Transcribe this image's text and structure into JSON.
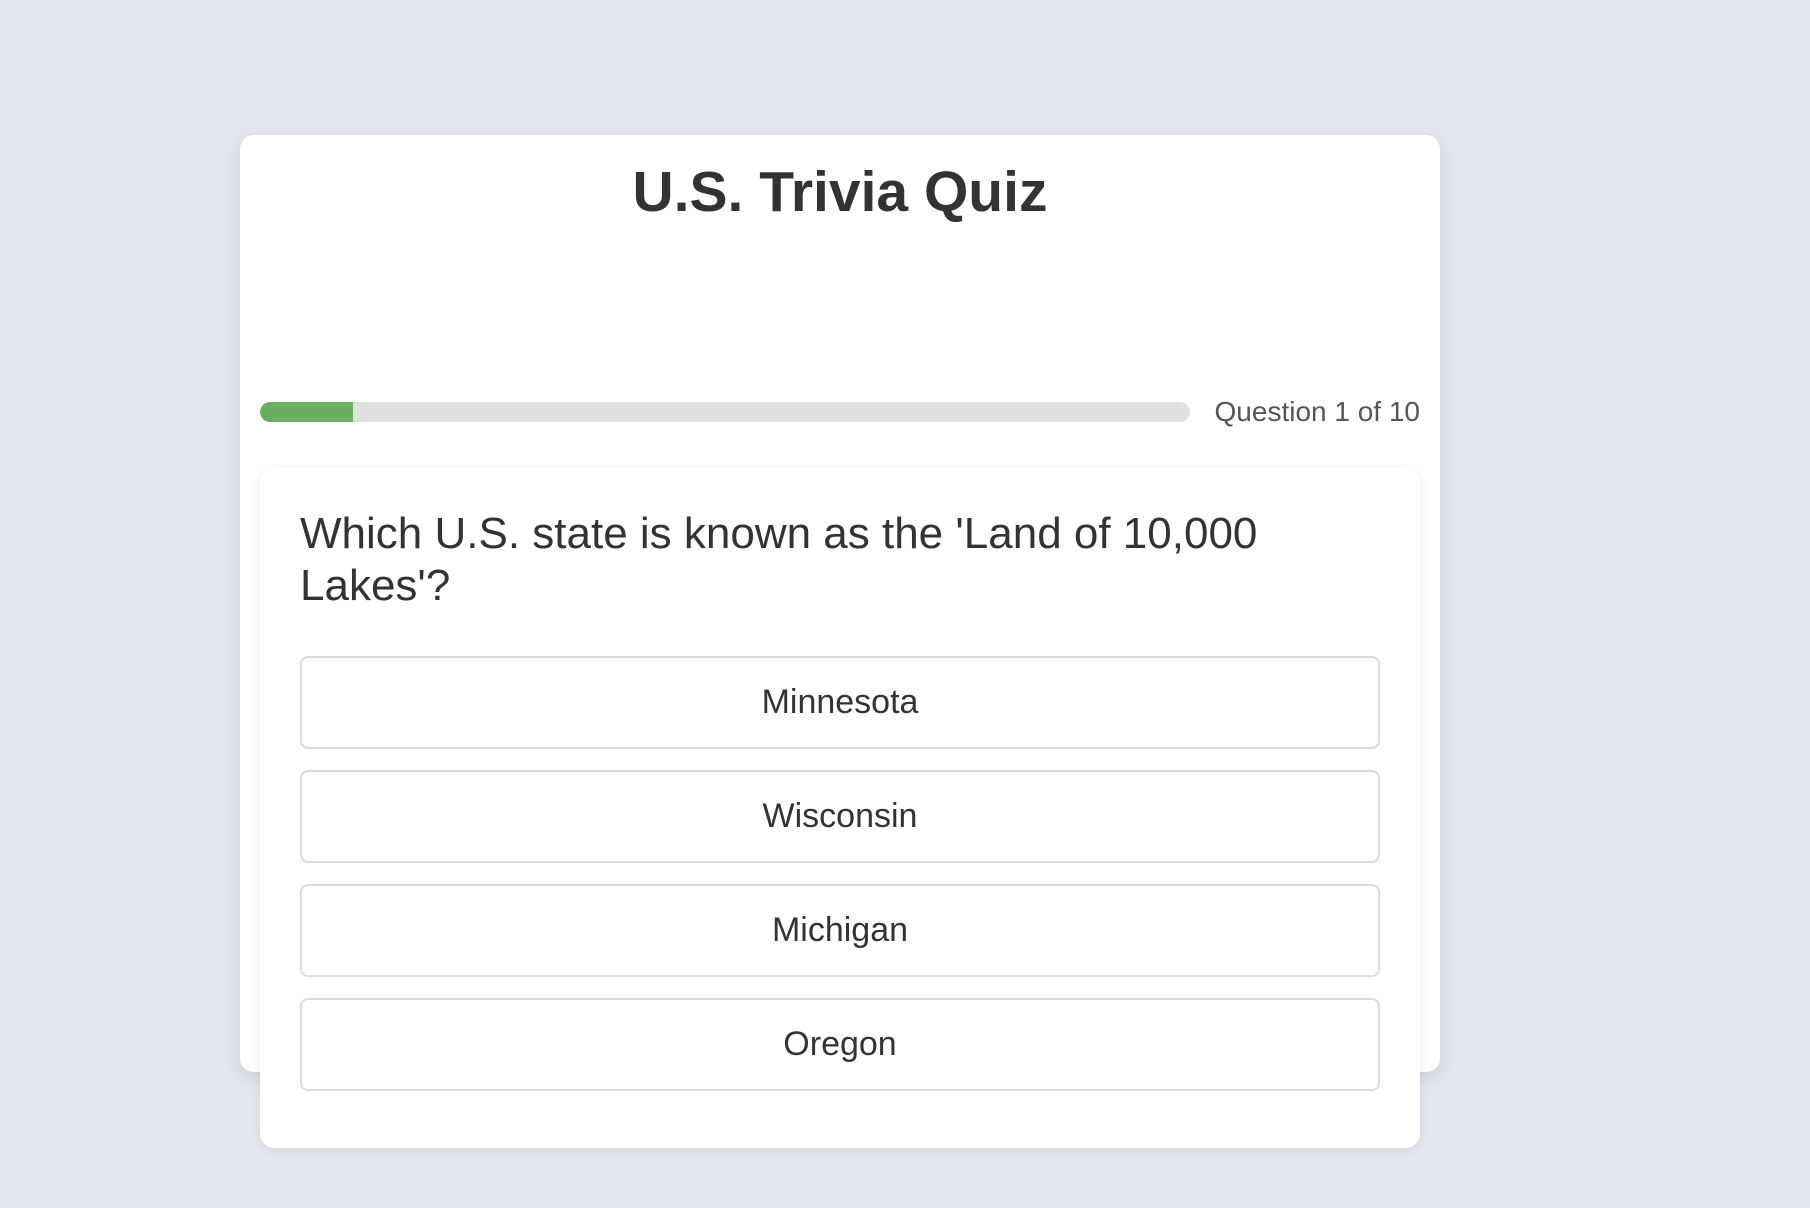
{
  "quiz": {
    "title": "U.S. Trivia Quiz",
    "progress": {
      "label": "Question 1 of 10",
      "fraction": 0.1,
      "fill_color": "#6aaf5f",
      "track_color": "#e0e0e0"
    },
    "question": {
      "text": "Which U.S. state is known as the 'Land of 10,000 Lakes'?"
    },
    "answers": [
      {
        "label": "Minnesota"
      },
      {
        "label": "Wisconsin"
      },
      {
        "label": "Michigan"
      },
      {
        "label": "Oregon"
      }
    ]
  }
}
